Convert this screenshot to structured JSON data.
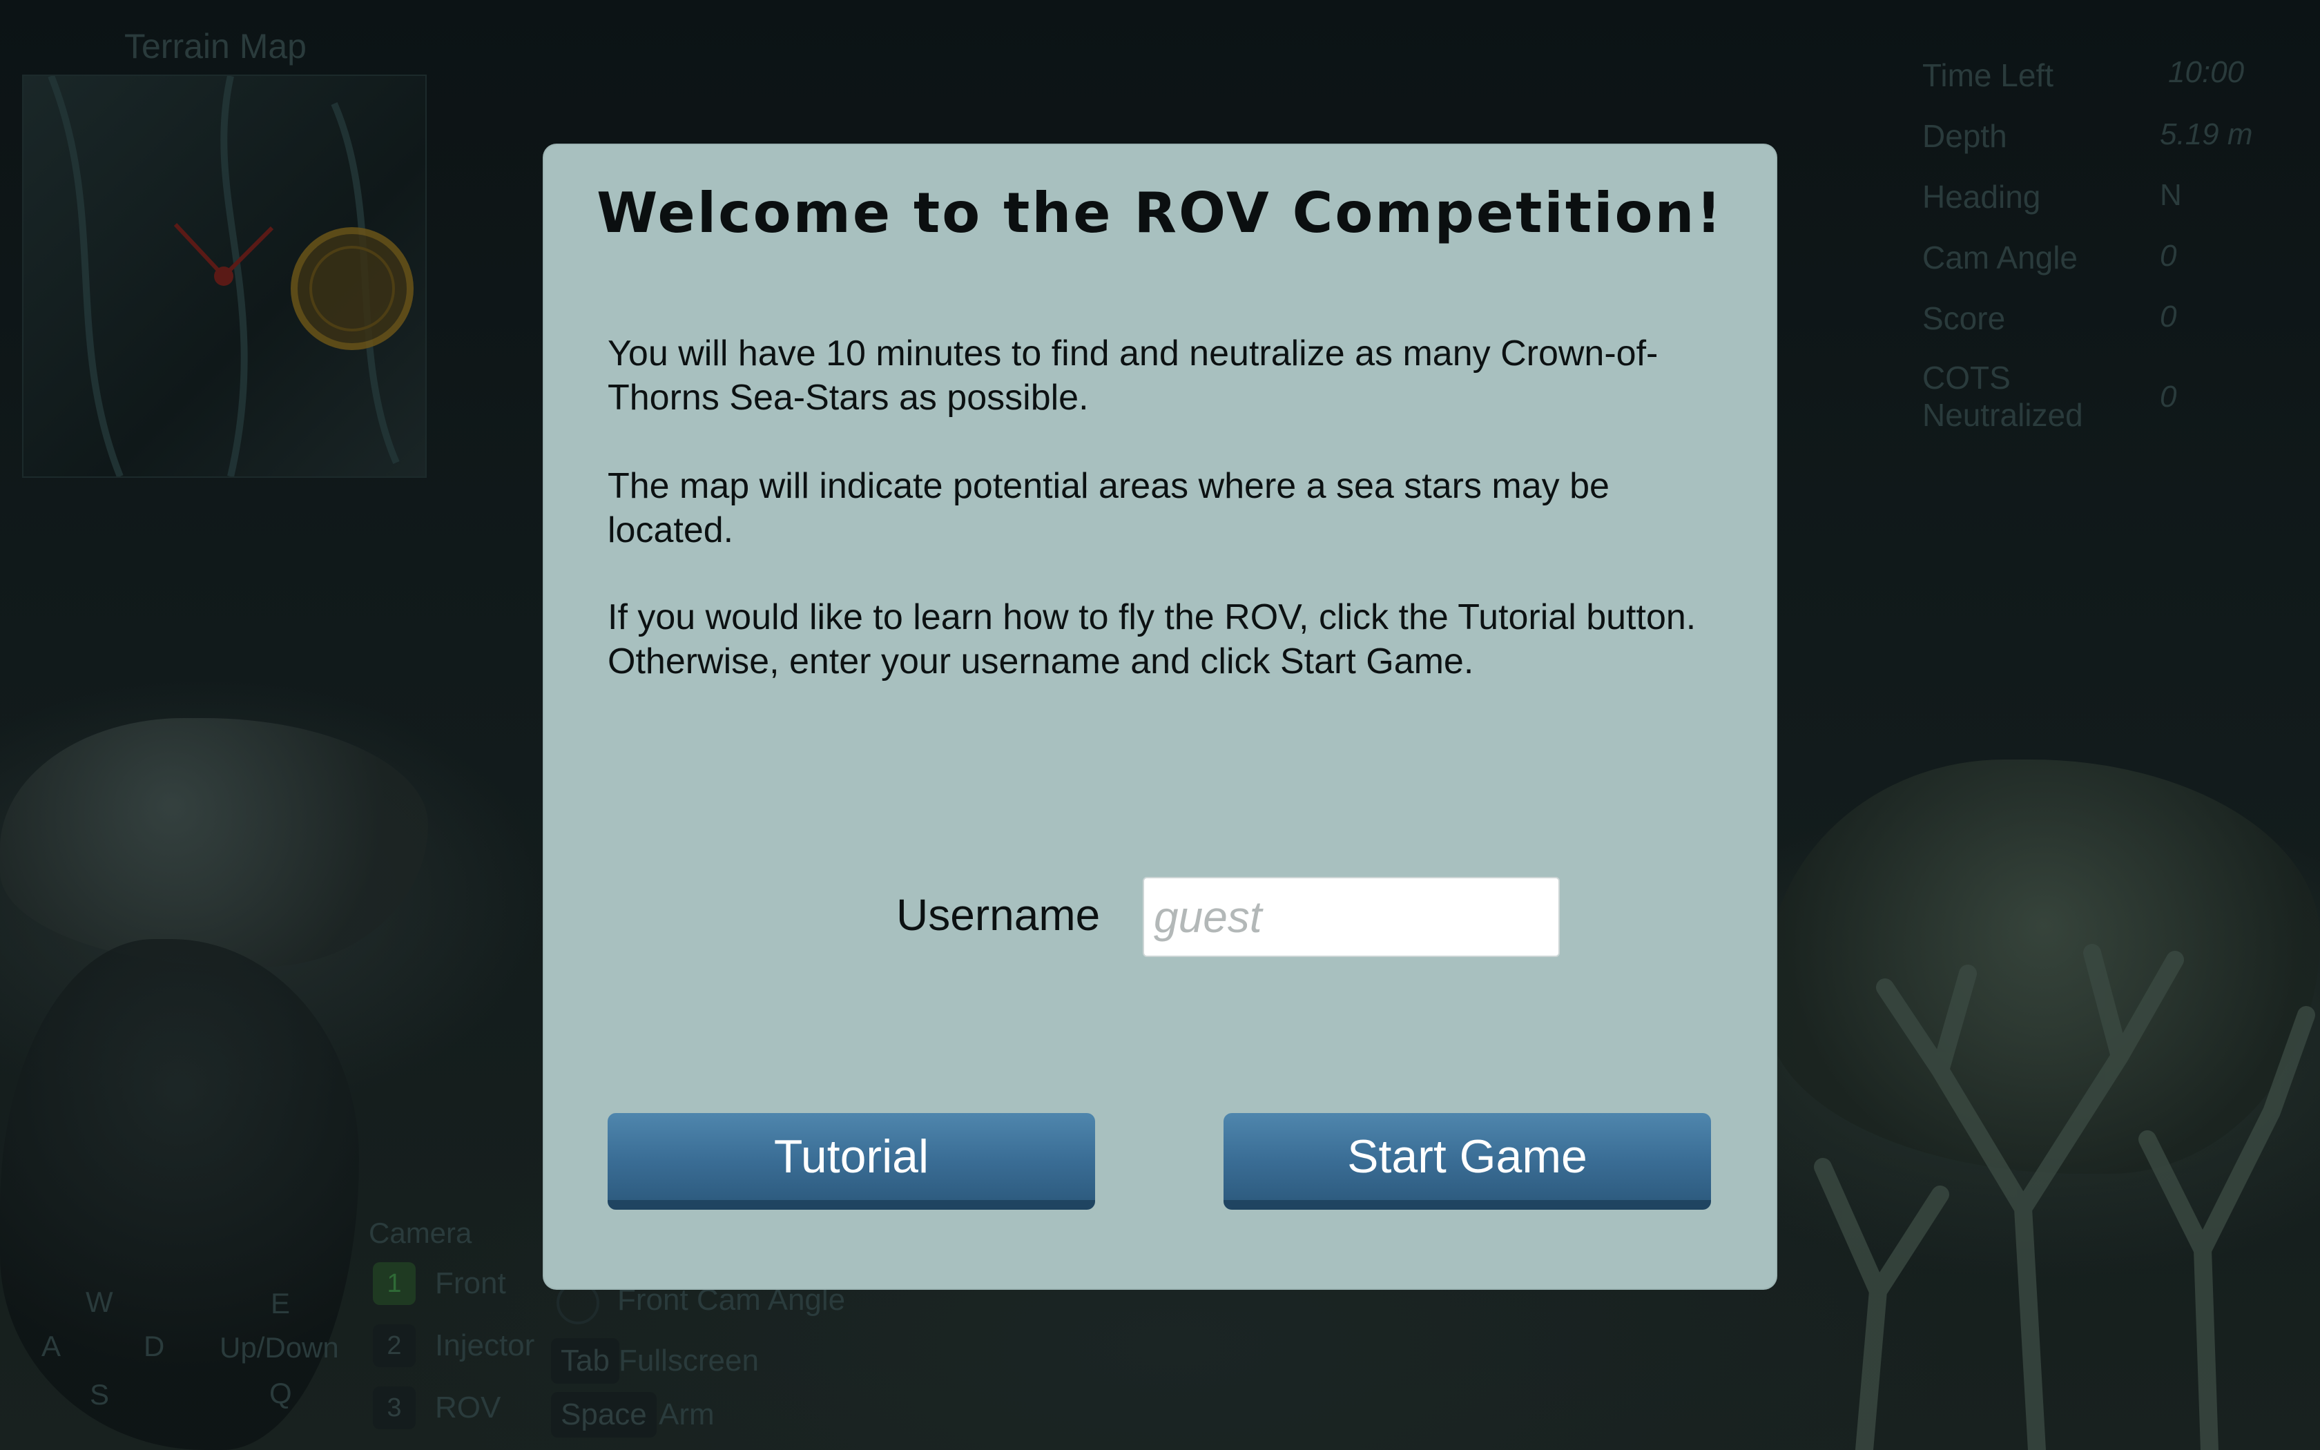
{
  "hud": {
    "map_title": "Terrain Map",
    "stats": [
      {
        "label": "Time Left",
        "value": "10:00"
      },
      {
        "label": "Depth",
        "value": "5.19 m"
      },
      {
        "label": "Heading",
        "value": "N"
      },
      {
        "label": "Cam Angle",
        "value": "0"
      },
      {
        "label": "Score",
        "value": "0"
      },
      {
        "label": "COTS Neutralized",
        "value": "0"
      }
    ],
    "movement_keys": {
      "w": "W",
      "a": "A",
      "s": "S",
      "d": "D",
      "e": "E",
      "q": "Q",
      "updown": "Up/Down"
    },
    "camera": {
      "title": "Camera",
      "items": [
        {
          "key": "1",
          "label": "Front"
        },
        {
          "key": "2",
          "label": "Injector"
        },
        {
          "key": "3",
          "label": "ROV"
        }
      ]
    },
    "controls": [
      {
        "key": "",
        "label": "Front Cam Angle"
      },
      {
        "key": "Tab",
        "label": "Fullscreen"
      },
      {
        "key": "Space",
        "label": "Arm"
      }
    ]
  },
  "modal": {
    "title": "Welcome to the ROV Competition!",
    "paragraphs": [
      "You will have 10 minutes to find and neutralize as many Crown-of-Thorns Sea-Stars as possible.",
      "The map will indicate potential areas where a sea stars may be located.",
      "If you would like to learn how to fly the ROV, click the Tutorial button. Otherwise, enter your username and click Start Game."
    ],
    "username_label": "Username",
    "username_placeholder": "guest",
    "tutorial_label": "Tutorial",
    "start_label": "Start Game"
  },
  "colors": {
    "modal_bg": "#a8c0bf",
    "button_blue": "#3a6d95",
    "camera_active": "#2f6a36"
  }
}
